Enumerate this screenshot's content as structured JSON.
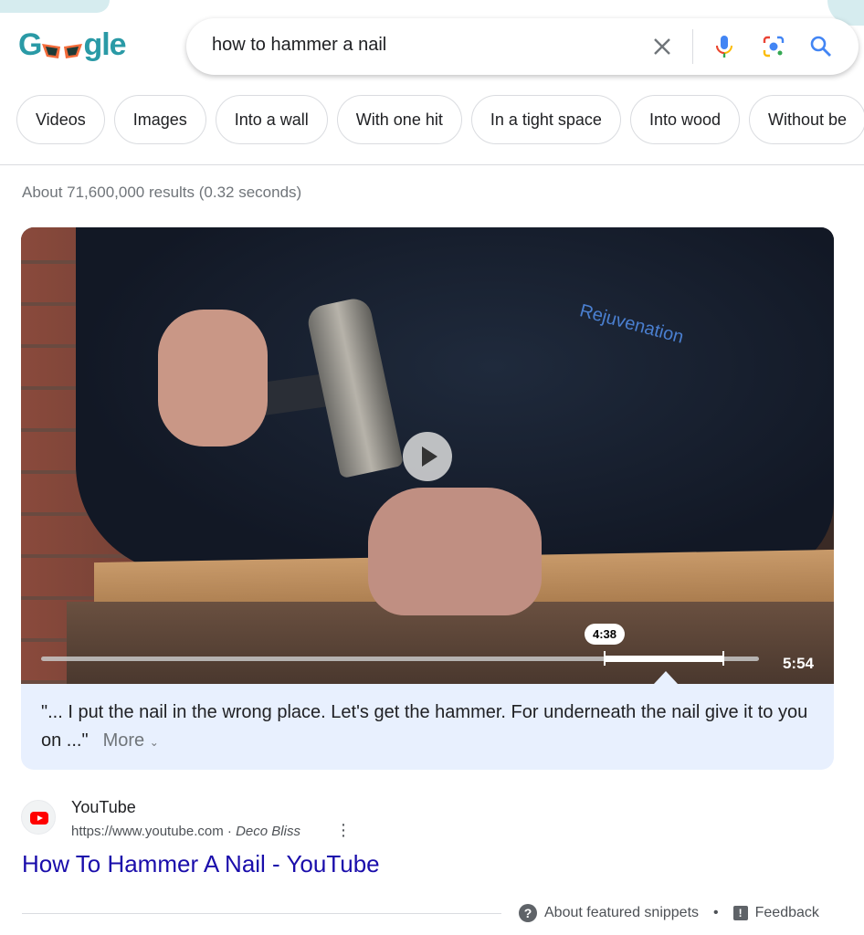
{
  "logo": {
    "text": "Google"
  },
  "search": {
    "query": "how to hammer a nail"
  },
  "chips": [
    "Videos",
    "Images",
    "Into a wall",
    "With one hit",
    "In a tight space",
    "Into wood",
    "Without be"
  ],
  "stats": "About 71,600,000 results (0.32 seconds)",
  "video": {
    "clip_start_label": "4:38",
    "duration": "5:54",
    "clip_start_fraction": 0.785,
    "clip_end_fraction": 0.95,
    "jacket_text": "Rejuvenation"
  },
  "snippet": {
    "quote": "\"... I put the nail in the wrong place. Let's get the hammer. For underneath the nail give it to you on ...\"",
    "more_label": "More"
  },
  "result": {
    "source": "YouTube",
    "url": "https://www.youtube.com",
    "author": "Deco Bliss",
    "title": "How To Hammer A Nail - YouTube"
  },
  "footer": {
    "about": "About featured snippets",
    "feedback": "Feedback"
  },
  "colors": {
    "link": "#1a0dab",
    "snippet_bg": "#e8f0fe",
    "youtube_red": "#ff0000"
  }
}
